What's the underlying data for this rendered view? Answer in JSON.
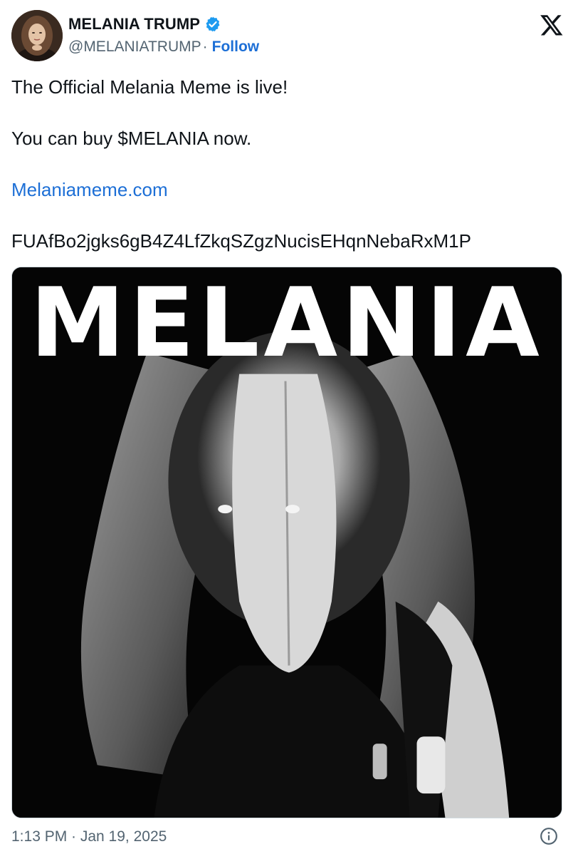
{
  "author": {
    "name": "MELANIA TRUMP",
    "handle": "@MELANIATRUMP",
    "separator": "·",
    "follow_label": "Follow",
    "verified_icon": "verified-badge-icon",
    "verified_color": "#1d9bf0"
  },
  "platform_icon": "x-logo-icon",
  "post": {
    "line1": "The Official Melania Meme is live!",
    "line2": "You can buy $MELANIA now.",
    "link": "Melaniameme.com",
    "line4": "FUAfBo2jgks6gB4Z4LfZkqSZgzNucisEHqnNebaRxM1P"
  },
  "media": {
    "overlay_text": "MELANIA",
    "description_icon": "black-and-white-portrait-image"
  },
  "footer": {
    "timestamp": "1:13 PM · Jan 19, 2025",
    "info_icon": "info-icon"
  },
  "colors": {
    "link": "#1d6fd6",
    "text": "#0f1419",
    "muted": "#536471"
  }
}
